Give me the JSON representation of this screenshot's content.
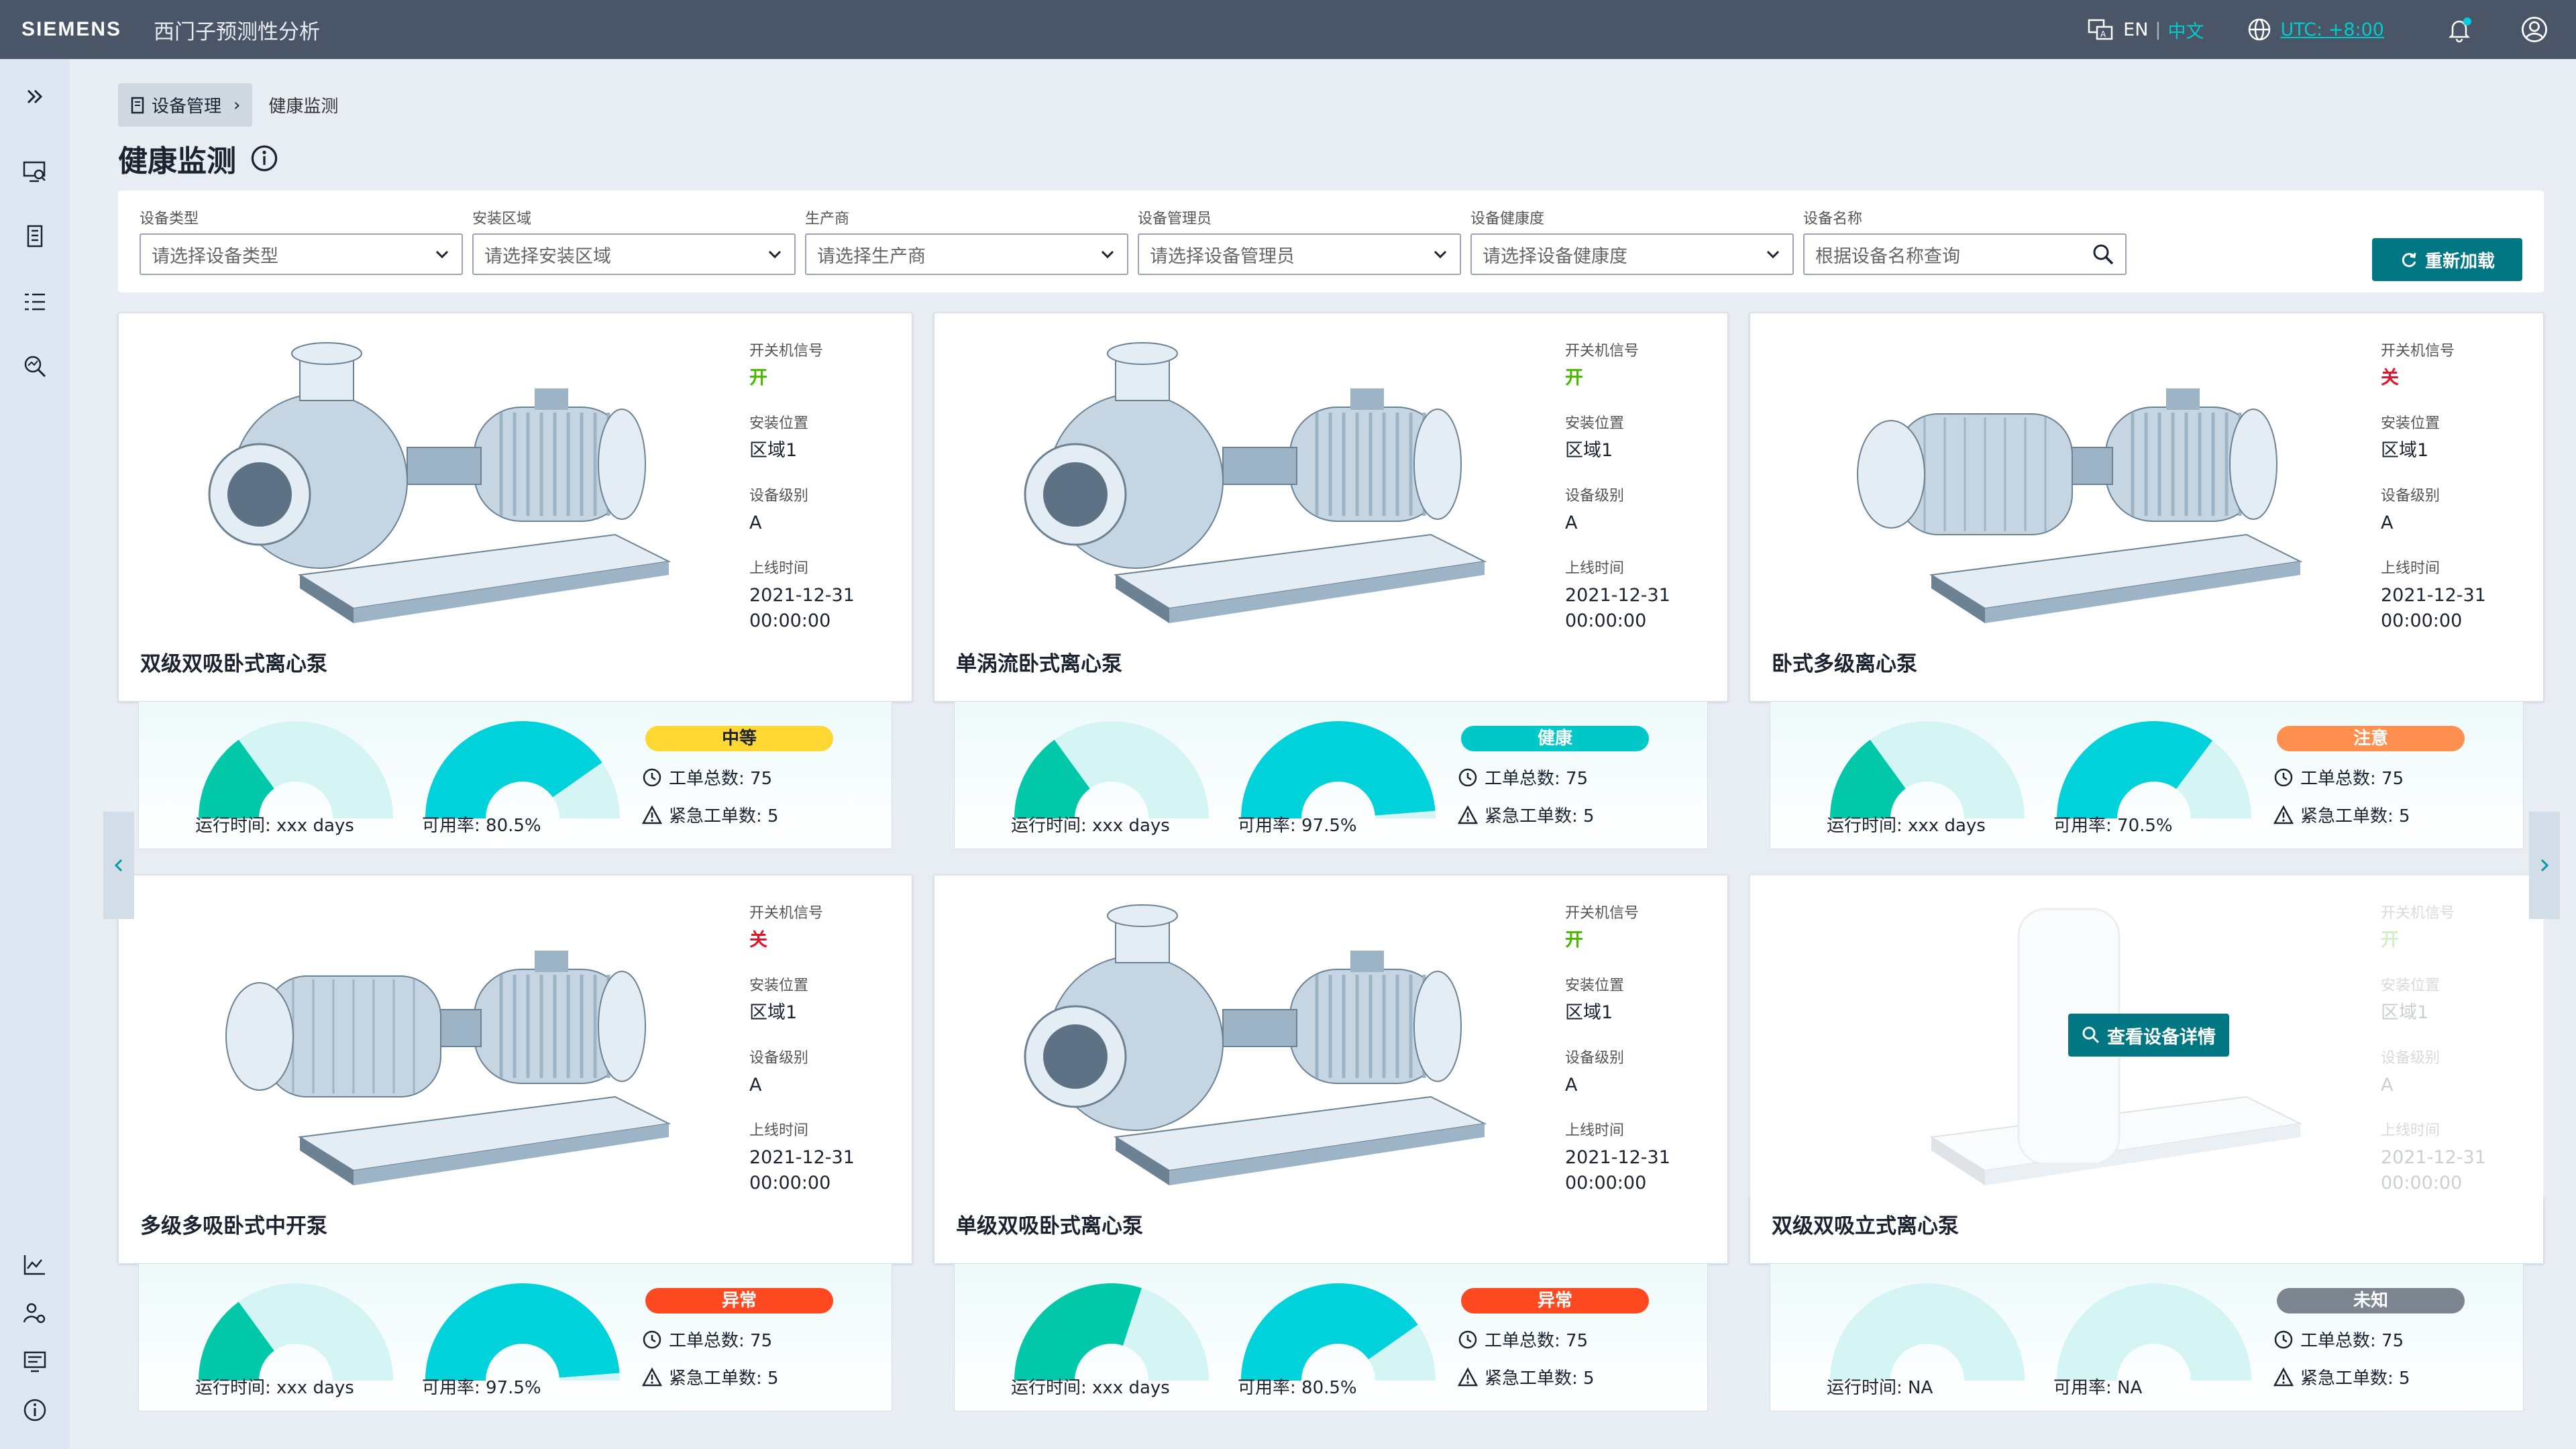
{
  "topbar": {
    "logo": "SIEMENS",
    "title": "西门子预测性分析",
    "lang_en": "EN",
    "lang_zh": "中文",
    "utc": "UTC: +8:00"
  },
  "breadcrumb": {
    "root": "设备管理",
    "current": "健康监测"
  },
  "page_title": "健康监测",
  "filters": [
    {
      "label": "设备类型",
      "placeholder": "请选择设备类型"
    },
    {
      "label": "安装区域",
      "placeholder": "请选择安装区域"
    },
    {
      "label": "生产商",
      "placeholder": "请选择生产商"
    },
    {
      "label": "设备管理员",
      "placeholder": "请选择设备管理员"
    },
    {
      "label": "设备健康度",
      "placeholder": "请选择设备健康度"
    },
    {
      "label": "设备名称",
      "placeholder": "根据设备名称查询"
    }
  ],
  "reload_label": "重新加载",
  "detail_label": "查看设备详情",
  "meta_labels": {
    "signal": "开关机信号",
    "location": "安装位置",
    "level": "设备级别",
    "online": "上线时间"
  },
  "kpi_labels": {
    "orders": "工单总数: 75",
    "urgent": "紧急工单数: 5"
  },
  "colors": {
    "accent": "#007782",
    "gauge": "#00d2dc",
    "gauge_green": "#00c8a8",
    "gauge_bg": "#d5f4f4"
  },
  "devices": [
    {
      "name": "双级双吸卧式离心泵",
      "signal": "开",
      "signal_on": true,
      "location": "区域1",
      "level": "A",
      "online_date": "2021-12-31",
      "online_time": "00:00:00",
      "runtime": "运行时间: xxx days",
      "runtime_frac": 0.3,
      "availability": "可用率: 80.5%",
      "availability_frac": 0.805,
      "status": "中等",
      "status_color": "#ffd732"
    },
    {
      "name": "单涡流卧式离心泵",
      "signal": "开",
      "signal_on": true,
      "location": "区域1",
      "level": "A",
      "online_date": "2021-12-31",
      "online_time": "00:00:00",
      "runtime": "运行时间: xxx days",
      "runtime_frac": 0.3,
      "availability": "可用率: 97.5%",
      "availability_frac": 0.975,
      "status": "健康",
      "status_color": "#00c8c8"
    },
    {
      "name": "卧式多级离心泵",
      "signal": "关",
      "signal_on": false,
      "location": "区域1",
      "level": "A",
      "online_date": "2021-12-31",
      "online_time": "00:00:00",
      "runtime": "运行时间: xxx days",
      "runtime_frac": 0.3,
      "availability": "可用率: 70.5%",
      "availability_frac": 0.705,
      "status": "注意",
      "status_color": "#ff9050"
    },
    {
      "name": "多级多吸卧式中开泵",
      "signal": "关",
      "signal_on": false,
      "location": "区域1",
      "level": "A",
      "online_date": "2021-12-31",
      "online_time": "00:00:00",
      "runtime": "运行时间: xxx days",
      "runtime_frac": 0.3,
      "availability": "可用率: 97.5%",
      "availability_frac": 0.975,
      "status": "异常",
      "status_color": "#ff4a21"
    },
    {
      "name": "单级双吸卧式离心泵",
      "signal": "开",
      "signal_on": true,
      "location": "区域1",
      "level": "A",
      "online_date": "2021-12-31",
      "online_time": "00:00:00",
      "runtime": "运行时间: xxx days",
      "runtime_frac": 0.6,
      "availability": "可用率: 80.5%",
      "availability_frac": 0.805,
      "status": "异常",
      "status_color": "#ff4a21"
    },
    {
      "name": "双级双吸立式离心泵",
      "signal": "开",
      "signal_on": true,
      "location": "区域1",
      "level": "A",
      "online_date": "2021-12-31",
      "online_time": "00:00:00",
      "runtime": "运行时间: NA",
      "runtime_frac": 0,
      "availability": "可用率: NA",
      "availability_frac": 0,
      "status": "未知",
      "status_color": "#7d8590"
    }
  ]
}
